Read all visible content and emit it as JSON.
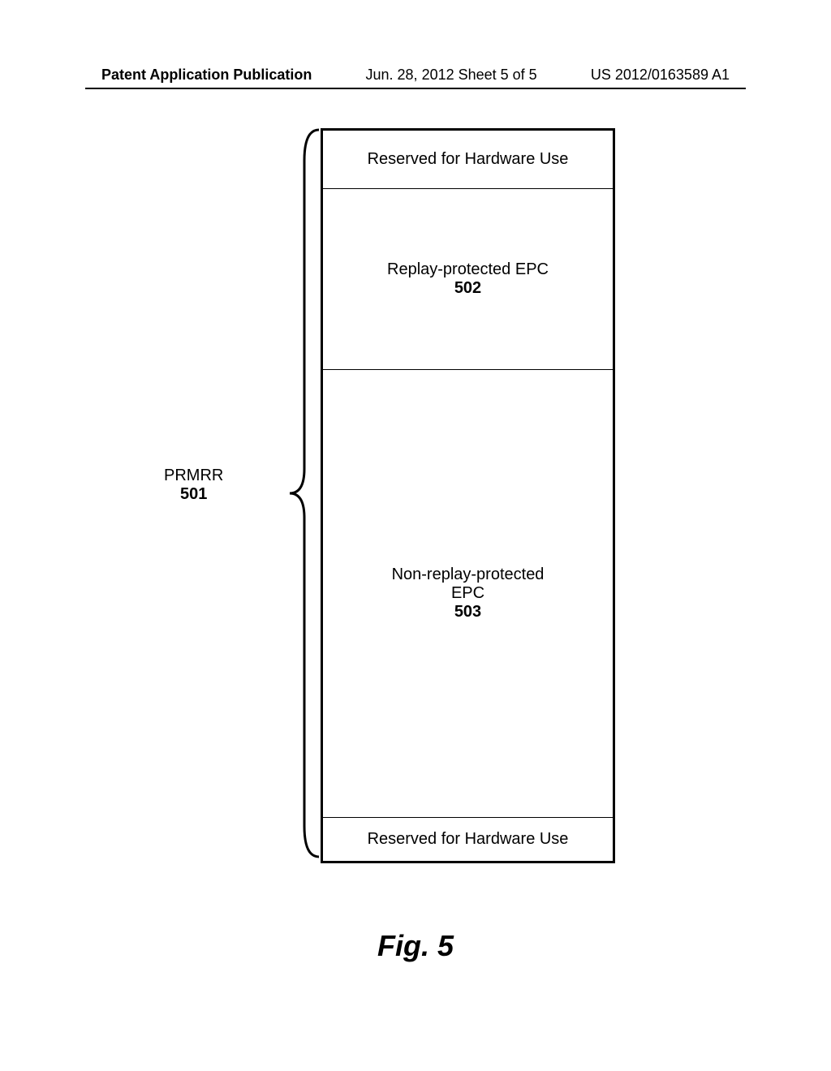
{
  "header": {
    "left": "Patent Application Publication",
    "center": "Jun. 28, 2012  Sheet 5 of 5",
    "right": "US 2012/0163589 A1"
  },
  "label": {
    "name": "PRMRR",
    "ref": "501"
  },
  "regions": {
    "hw_top": "Reserved for Hardware Use",
    "replay": {
      "name": "Replay-protected EPC",
      "ref": "502"
    },
    "nonreplay": {
      "line1": "Non-replay-protected",
      "line2": "EPC",
      "ref": "503"
    },
    "hw_bottom": "Reserved for Hardware Use"
  },
  "caption": "Fig. 5"
}
